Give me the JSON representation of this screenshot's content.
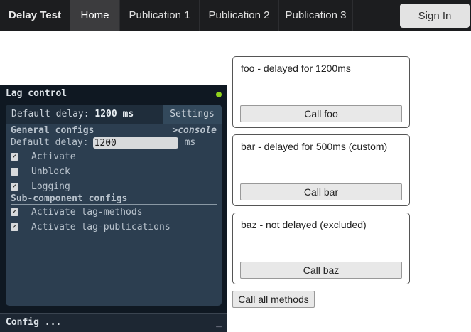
{
  "nav": {
    "brand": "Delay Test",
    "items": [
      "Home",
      "Publication 1",
      "Publication 2",
      "Publication 3"
    ],
    "active": "Home",
    "sign_in": "Sign In"
  },
  "lag": {
    "title": "Lag control",
    "status_color": "#8fd11c",
    "tab_label": "Default delay:",
    "tab_value": "1200 ms",
    "settings": "Settings",
    "general": "General configs",
    "console": ">console",
    "delay_label": "Default delay:",
    "delay_value": "1200",
    "delay_unit": "ms",
    "options": [
      {
        "label": "Activate",
        "checked": true
      },
      {
        "label": "Unblock",
        "checked": false
      },
      {
        "label": "Logging",
        "checked": true
      }
    ],
    "sub": "Sub-component configs",
    "sub_options": [
      {
        "label": "Activate lag-methods",
        "checked": true
      },
      {
        "label": "Activate lag-publications",
        "checked": true
      }
    ],
    "config": "Config ...",
    "minimize": "_"
  },
  "methods": [
    {
      "title": "foo - delayed for 1200ms",
      "button": "Call foo"
    },
    {
      "title": "bar - delayed for 500ms (custom)",
      "button": "Call bar"
    },
    {
      "title": "baz - not delayed (excluded)",
      "button": "Call baz"
    }
  ],
  "call_all": "Call all methods"
}
